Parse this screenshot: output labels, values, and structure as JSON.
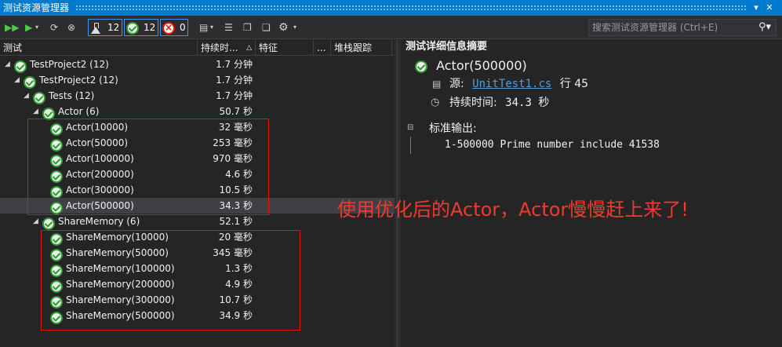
{
  "window": {
    "title": "测试资源管理器"
  },
  "toolbar": {
    "counters": [
      {
        "icon": "flask-icon",
        "value": "12"
      },
      {
        "icon": "check-circle-icon",
        "value": "12"
      },
      {
        "icon": "x-circle-icon",
        "value": "0"
      }
    ],
    "search_placeholder": "搜索测试资源管理器 (Ctrl+E)"
  },
  "columns": {
    "test": "测试",
    "duration": "持续时...",
    "traits": "特征",
    "more": "...",
    "stack": "堆栈跟踪"
  },
  "tree": [
    {
      "name": "TestProject2 (12)",
      "duration": "1.7 分钟",
      "level": 0,
      "expanded": true
    },
    {
      "name": "TestProject2 (12)",
      "duration": "1.7 分钟",
      "level": 1,
      "expanded": true
    },
    {
      "name": "Tests (12)",
      "duration": "1.7 分钟",
      "level": 2,
      "expanded": true
    },
    {
      "name": "Actor (6)",
      "duration": "50.7 秒",
      "level": 3,
      "expanded": true
    },
    {
      "name": "Actor(10000)",
      "duration": "32 毫秒",
      "level": 4
    },
    {
      "name": "Actor(50000)",
      "duration": "253 毫秒",
      "level": 4
    },
    {
      "name": "Actor(100000)",
      "duration": "970 毫秒",
      "level": 4
    },
    {
      "name": "Actor(200000)",
      "duration": "4.6 秒",
      "level": 4
    },
    {
      "name": "Actor(300000)",
      "duration": "10.5 秒",
      "level": 4
    },
    {
      "name": "Actor(500000)",
      "duration": "34.3 秒",
      "level": 4,
      "selected": true
    },
    {
      "name": "ShareMemory (6)",
      "duration": "52.1 秒",
      "level": 3,
      "expanded": true
    },
    {
      "name": "ShareMemory(10000)",
      "duration": "20 毫秒",
      "level": 4
    },
    {
      "name": "ShareMemory(50000)",
      "duration": "345 毫秒",
      "level": 4
    },
    {
      "name": "ShareMemory(100000)",
      "duration": "1.3 秒",
      "level": 4
    },
    {
      "name": "ShareMemory(200000)",
      "duration": "4.9 秒",
      "level": 4
    },
    {
      "name": "ShareMemory(300000)",
      "duration": "10.7 秒",
      "level": 4
    },
    {
      "name": "ShareMemory(500000)",
      "duration": "34.9 秒",
      "level": 4
    }
  ],
  "details": {
    "title": "测试详细信息摘要",
    "test_name": "Actor(500000)",
    "source_label": "源:",
    "source_file": "UnitTest1.cs",
    "source_line": "行 45",
    "duration_label": "持续时间:",
    "duration_value": "34.3 秒",
    "output_label": "标准输出:",
    "output_text": "1-500000 Prime number include 41538"
  },
  "annotation": "使用优化后的Actor，Actor慢慢赶上来了!",
  "colors": {
    "accent": "#007acc",
    "pass": "#2f9a2f",
    "fail": "#e51400",
    "highlight_box": "#e51400",
    "annotation": "#f03a2e",
    "link": "#569cd6"
  }
}
